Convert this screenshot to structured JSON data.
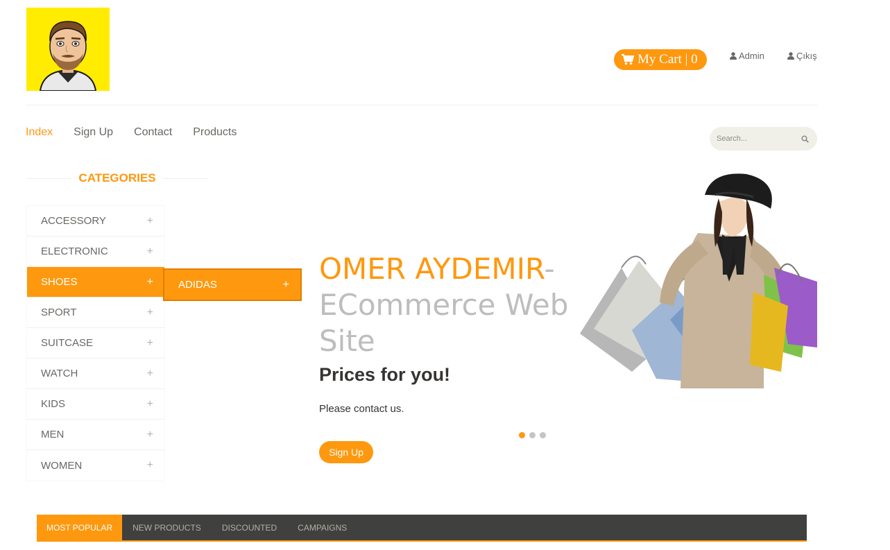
{
  "header": {
    "cart_label": "My Cart | 0",
    "admin_label": "Admin",
    "logout_label": "Çıkış"
  },
  "nav": {
    "items": [
      {
        "label": "Index",
        "active": true
      },
      {
        "label": "Sign Up",
        "active": false
      },
      {
        "label": "Contact",
        "active": false
      },
      {
        "label": "Products",
        "active": false
      }
    ]
  },
  "search": {
    "placeholder": "Search..."
  },
  "categories": {
    "title": "CATEGORIES",
    "items": [
      {
        "label": "ACCESSORY"
      },
      {
        "label": "ELECTRONIC"
      },
      {
        "label": "SHOES"
      },
      {
        "label": "SPORT"
      },
      {
        "label": "SUITCASE"
      },
      {
        "label": "WATCH"
      },
      {
        "label": "KIDS"
      },
      {
        "label": "MEN"
      },
      {
        "label": "WOMEN"
      }
    ],
    "plus_symbol": "+",
    "submenu": {
      "label": "ADIDAS"
    }
  },
  "slider": {
    "title_highlight": "OMER AYDEMIR",
    "title_rest": "-ECommerce Web Site",
    "subtitle": "Prices for you!",
    "text": "Please contact us.",
    "button_label": "Sign Up",
    "active_slide": 1,
    "slide_count": 3
  },
  "tabs": {
    "items": [
      {
        "label": "MOST POPULAR",
        "active": true
      },
      {
        "label": "NEW PRODUCTS",
        "active": false
      },
      {
        "label": "DISCOUNTED",
        "active": false
      },
      {
        "label": "CAMPAIGNS",
        "active": false
      }
    ]
  },
  "colors": {
    "accent": "#fe980f",
    "dark": "#40403e",
    "text": "#696763"
  }
}
